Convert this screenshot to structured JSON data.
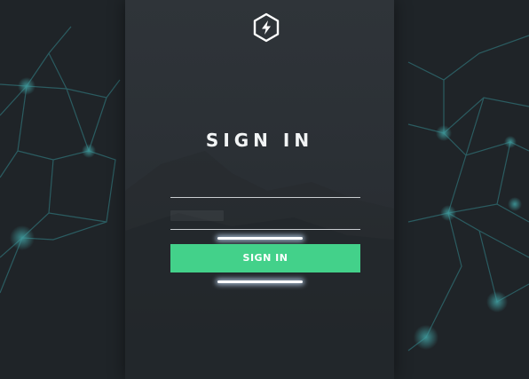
{
  "form": {
    "title": "SIGN IN",
    "username": {
      "value": "",
      "placeholder": ""
    },
    "password": {
      "value": "",
      "placeholder": ""
    },
    "submit_label": "SIGN IN"
  },
  "theme": {
    "accent": "#43d18a",
    "background": "#1f2428",
    "panel": "#2d3237",
    "network_lines": "#2f6f74"
  },
  "icons": {
    "logo": "lightning-hexagon-icon"
  }
}
